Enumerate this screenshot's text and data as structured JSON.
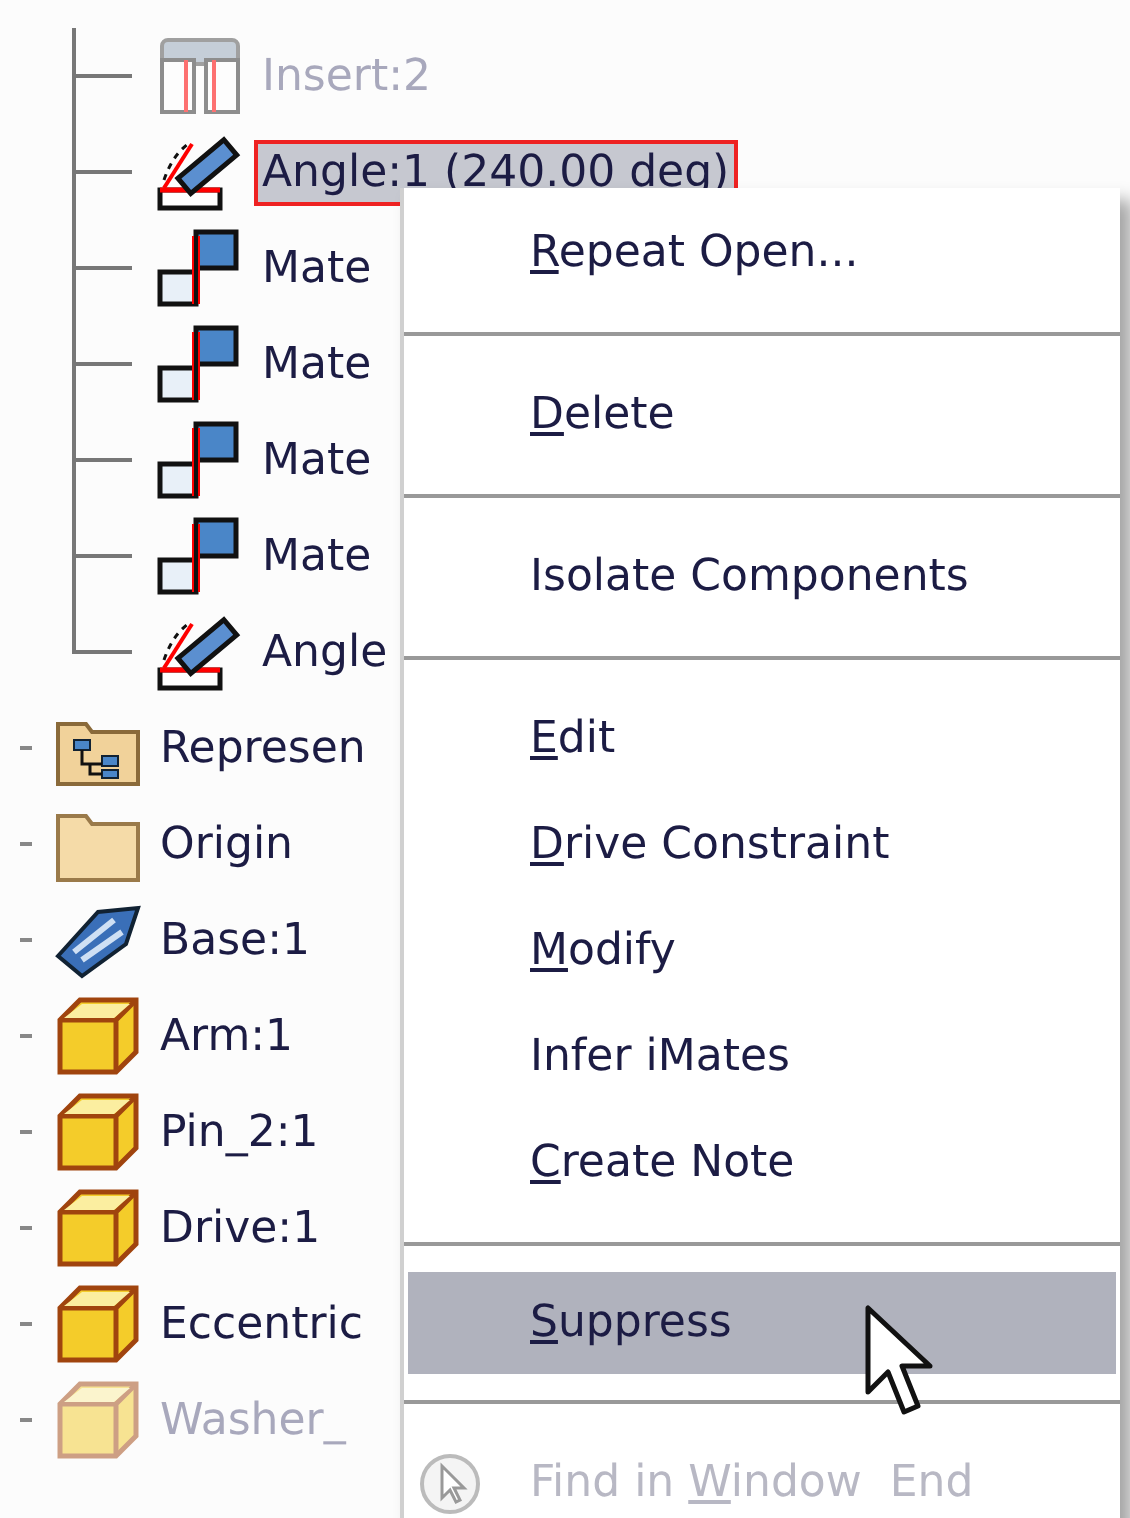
{
  "tree": {
    "nested_items": [
      {
        "label": "Insert:2",
        "kind": "insert",
        "dimmed": true,
        "selected": false
      },
      {
        "label": "Angle:1 (240.00 deg)",
        "kind": "angle",
        "dimmed": false,
        "selected": true
      },
      {
        "label": "Mate",
        "kind": "mate",
        "dimmed": false,
        "selected": false
      },
      {
        "label": "Mate",
        "kind": "mate",
        "dimmed": false,
        "selected": false
      },
      {
        "label": "Mate",
        "kind": "mate",
        "dimmed": false,
        "selected": false
      },
      {
        "label": "Mate",
        "kind": "mate",
        "dimmed": false,
        "selected": false
      },
      {
        "label": "Angle",
        "kind": "angle",
        "dimmed": false,
        "selected": false
      }
    ],
    "items": [
      {
        "label": "Represen",
        "kind": "representations",
        "dimmed": false,
        "selected": false
      },
      {
        "label": "Origin",
        "kind": "folder",
        "dimmed": false,
        "selected": false
      },
      {
        "label": "Base:1",
        "kind": "base",
        "dimmed": false,
        "selected": false
      },
      {
        "label": "Arm:1",
        "kind": "part",
        "dimmed": false,
        "selected": false
      },
      {
        "label": "Pin_2:1",
        "kind": "part",
        "dimmed": false,
        "selected": false
      },
      {
        "label": "Drive:1",
        "kind": "part",
        "dimmed": false,
        "selected": false
      },
      {
        "label": "Eccentric",
        "kind": "part",
        "dimmed": false,
        "selected": false
      },
      {
        "label": "Washer_",
        "kind": "part",
        "dimmed": true,
        "selected": false
      }
    ]
  },
  "context_menu": {
    "groups": [
      [
        {
          "parts": [
            {
              "text": "R",
              "underlined": true
            },
            {
              "text": "epeat Open...",
              "underlined": false
            }
          ],
          "kind": "plain",
          "selected": false,
          "disabled": false
        }
      ],
      [
        {
          "parts": [
            {
              "text": "D",
              "underlined": true
            },
            {
              "text": "elete",
              "underlined": false
            }
          ],
          "kind": "plain",
          "selected": false,
          "disabled": false
        }
      ],
      [
        {
          "parts": [
            {
              "text": "Isolate Components",
              "underlined": false
            }
          ],
          "kind": "plain",
          "selected": false,
          "disabled": false
        }
      ],
      [
        {
          "parts": [
            {
              "text": "E",
              "underlined": true
            },
            {
              "text": "dit",
              "underlined": false
            }
          ],
          "kind": "plain",
          "selected": false,
          "disabled": false
        },
        {
          "parts": [
            {
              "text": "D",
              "underlined": true
            },
            {
              "text": "rive Constraint",
              "underlined": false
            }
          ],
          "kind": "plain",
          "selected": false,
          "disabled": false
        },
        {
          "parts": [
            {
              "text": "M",
              "underlined": true
            },
            {
              "text": "odify",
              "underlined": false
            }
          ],
          "kind": "plain",
          "selected": false,
          "disabled": false
        },
        {
          "parts": [
            {
              "text": "Infer iMates",
              "underlined": false
            }
          ],
          "kind": "plain",
          "selected": false,
          "disabled": false
        },
        {
          "parts": [
            {
              "text": "C",
              "underlined": true
            },
            {
              "text": "reate Note",
              "underlined": false
            }
          ],
          "kind": "plain",
          "selected": false,
          "disabled": false
        }
      ],
      [
        {
          "parts": [
            {
              "text": "S",
              "underlined": true
            },
            {
              "text": "uppress",
              "underlined": false
            }
          ],
          "kind": "plain",
          "selected": true,
          "disabled": false
        }
      ],
      [
        {
          "parts": [
            {
              "text": "Find in ",
              "underlined": false
            },
            {
              "text": "W",
              "underlined": true
            },
            {
              "text": "indow  End",
              "underlined": false
            }
          ],
          "kind": "with-icon",
          "selected": false,
          "disabled": true
        }
      ]
    ]
  }
}
